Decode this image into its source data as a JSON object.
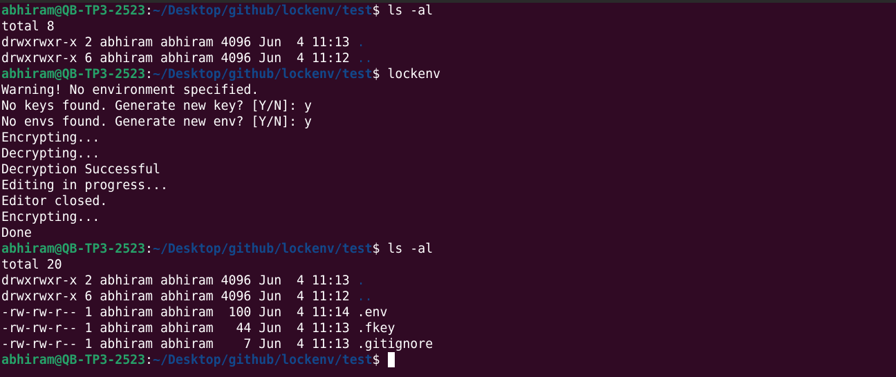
{
  "prompt": {
    "user_host": "abhiram@QB-TP3-2523",
    "colon": ":",
    "path": "~/Desktop/github/lockenv/test",
    "dollar": "$"
  },
  "commands": {
    "cmd1": " ls -al",
    "cmd2": " lockenv",
    "cmd3": " ls -al"
  },
  "output1": {
    "total": "total 8",
    "rows": [
      {
        "text": "drwxrwxr-x 2 abhiram abhiram 4096 Jun  4 11:13 ",
        "name": "."
      },
      {
        "text": "drwxrwxr-x 6 abhiram abhiram 4096 Jun  4 11:12 ",
        "name": ".."
      }
    ]
  },
  "output2": [
    "Warning! No environment specified.",
    "No keys found. Generate new key? [Y/N]: y",
    "No envs found. Generate new env? [Y/N]: y",
    "Encrypting...",
    "Decrypting...",
    "Decryption Successful",
    "Editing in progress...",
    "Editor closed.",
    "Encrypting...",
    "Done"
  ],
  "output3": {
    "total": "total 20",
    "rows": [
      {
        "text": "drwxrwxr-x 2 abhiram abhiram 4096 Jun  4 11:13 ",
        "name": "."
      },
      {
        "text": "drwxrwxr-x 6 abhiram abhiram 4096 Jun  4 11:12 ",
        "name": ".."
      },
      {
        "text": "-rw-rw-r-- 1 abhiram abhiram  100 Jun  4 11:14 ",
        "name": ".env"
      },
      {
        "text": "-rw-rw-r-- 1 abhiram abhiram   44 Jun  4 11:13 ",
        "name": ".fkey"
      },
      {
        "text": "-rw-rw-r-- 1 abhiram abhiram    7 Jun  4 11:13 ",
        "name": ".gitignore"
      }
    ]
  },
  "colors": {
    "background": "#300a24",
    "user_host": "#26a269",
    "path": "#12488b",
    "text": "#ffffff"
  }
}
